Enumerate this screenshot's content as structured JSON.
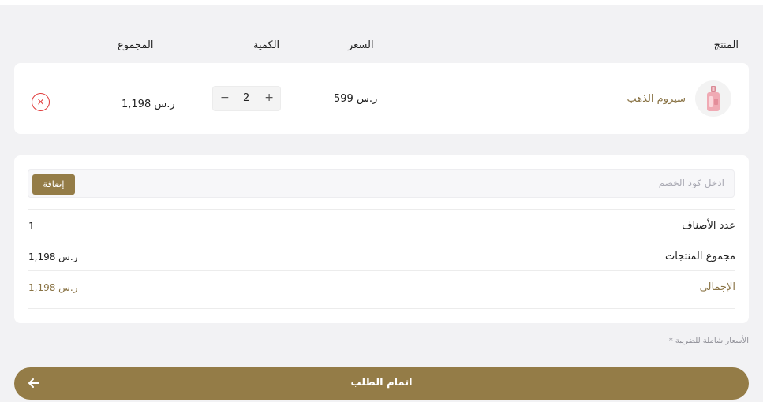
{
  "table_header": {
    "product": "المنتج",
    "price": "السعر",
    "quantity": "الكمية",
    "total": "المجموع"
  },
  "cart_item": {
    "image_icon": "serum-bottle-icon",
    "name": "سيروم الذهب",
    "price": "599 ر.س",
    "quantity": "2",
    "minus": "−",
    "plus": "+",
    "line_total": "1,198 ر.س",
    "remove_icon": "×"
  },
  "coupon": {
    "placeholder": "ادخل كود الخصم",
    "value": "",
    "apply_label": "إضافة"
  },
  "summary": {
    "items_count_label": "عدد الأصناف",
    "items_count_value": "1",
    "subtotal_label": "مجموع المنتجات",
    "subtotal_value": "1,198 ر.س",
    "grand_total_label": "الإجمالي",
    "grand_total_value": "1,198 ر.س"
  },
  "tax_note": "* الأسعار شاملة للضريبة",
  "checkout": {
    "label": "اتمام الطلب",
    "icon": "arrow-left-icon"
  },
  "colors": {
    "accent": "#947c47",
    "accent_text": "#8a7446",
    "danger": "#e03a3a",
    "background": "#f2f2f4",
    "card": "#ffffff"
  }
}
